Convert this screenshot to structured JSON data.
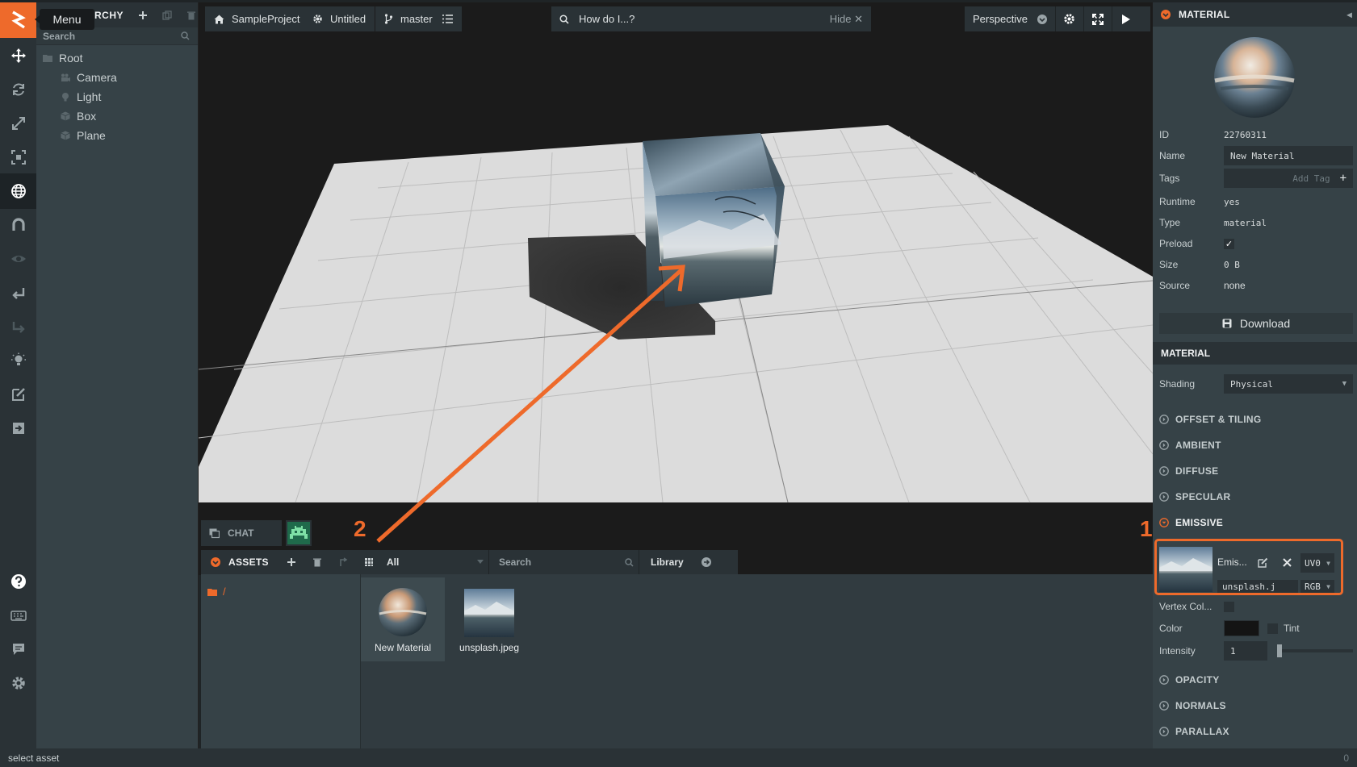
{
  "tooltip": {
    "menu": "Menu"
  },
  "hierarchy": {
    "title": "HIERARCHY",
    "title_visible": "RCHY",
    "search_label": "Search",
    "items": [
      {
        "label": "Root",
        "icon": "folder-icon"
      },
      {
        "label": "Camera",
        "icon": "camera-icon"
      },
      {
        "label": "Light",
        "icon": "light-icon"
      },
      {
        "label": "Box",
        "icon": "box-icon"
      },
      {
        "label": "Plane",
        "icon": "box-icon"
      }
    ]
  },
  "topbar": {
    "project": "SampleProject",
    "scene": "Untitled",
    "branch": "master",
    "help_placeholder": "How do I...?",
    "help_hide": "Hide",
    "camera": "Perspective"
  },
  "chat": {
    "label": "CHAT"
  },
  "assets": {
    "title": "ASSETS",
    "filter": "All",
    "search_placeholder": "Search",
    "library": "Library",
    "path": "/",
    "items": [
      {
        "name": "New Material",
        "kind": "material"
      },
      {
        "name": "unsplash.jpeg",
        "kind": "texture"
      }
    ]
  },
  "inspector": {
    "header": "MATERIAL",
    "props": {
      "id_label": "ID",
      "id": "22760311",
      "name_label": "Name",
      "name": "New Material",
      "tags_label": "Tags",
      "tags_placeholder": "Add Tag",
      "runtime_label": "Runtime",
      "runtime": "yes",
      "type_label": "Type",
      "type": "material",
      "preload_label": "Preload",
      "size_label": "Size",
      "size": "0 B",
      "source_label": "Source",
      "source": "none"
    },
    "download": "Download",
    "material_header": "MATERIAL",
    "shading_label": "Shading",
    "shading_value": "Physical",
    "sections_top": [
      "OFFSET & TILING",
      "AMBIENT",
      "DIFFUSE",
      "SPECULAR"
    ],
    "emissive": {
      "title": "EMISSIVE",
      "slot_label": "Emis...",
      "uv": "UV0",
      "texture_name": "unsplash.j",
      "channel": "RGB",
      "vertex_label": "Vertex Col...",
      "color_label": "Color",
      "tint_label": "Tint",
      "intensity_label": "Intensity",
      "intensity": "1"
    },
    "sections_bottom": [
      "OPACITY",
      "NORMALS",
      "PARALLAX"
    ]
  },
  "annotations": {
    "marker1": "1",
    "marker2": "2",
    "accent": "#ee6a2b"
  },
  "status": {
    "message": "select asset",
    "count": "0"
  }
}
